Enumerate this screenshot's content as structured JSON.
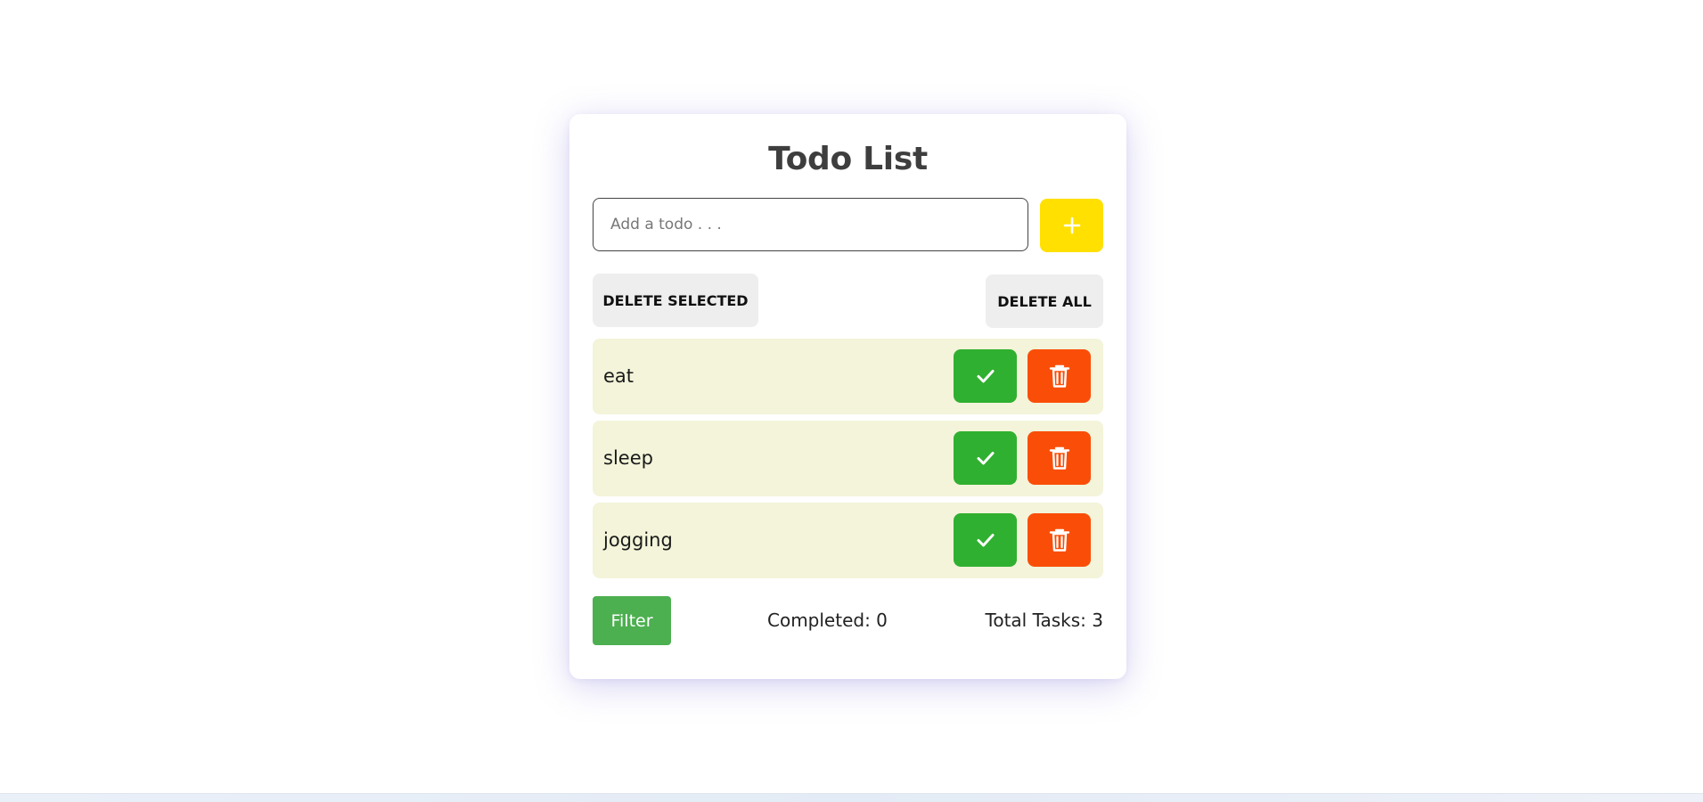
{
  "app": {
    "title": "Todo List"
  },
  "input": {
    "placeholder": "Add a todo . . .",
    "value": ""
  },
  "add_button": {
    "icon": "plus-icon",
    "color": "#ffe000"
  },
  "actions": {
    "delete_selected_label": "DELETE SELECTED",
    "delete_all_label": "DELETE ALL"
  },
  "todos": [
    {
      "text": "eat",
      "complete_icon": "check-icon",
      "delete_icon": "trash-icon"
    },
    {
      "text": "sleep",
      "complete_icon": "check-icon",
      "delete_icon": "trash-icon"
    },
    {
      "text": "jogging",
      "complete_icon": "check-icon",
      "delete_icon": "trash-icon"
    }
  ],
  "footer": {
    "filter_label": "Filter",
    "completed_label": "Completed: 0",
    "total_label": "Total Tasks: 3"
  },
  "colors": {
    "add": "#ffe000",
    "complete": "#30b030",
    "delete": "#fa4e08",
    "filter": "#4caf50",
    "item_bg": "#f3f4d9",
    "action_bg": "#eeeeee"
  }
}
